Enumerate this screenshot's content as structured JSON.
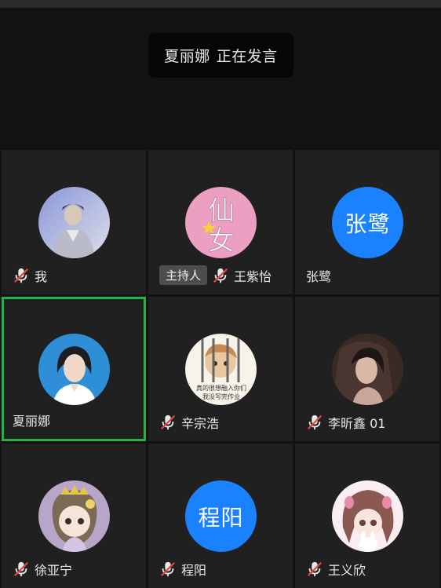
{
  "speaking_banner": {
    "name": "夏丽娜",
    "status": "正在发言"
  },
  "host_badge": "主持人",
  "participants": [
    {
      "name": "我",
      "muted": true,
      "avatar": "photo-man-jacket"
    },
    {
      "name": "王紫怡",
      "muted": true,
      "avatar": "pink-xian-nu",
      "host": true
    },
    {
      "name": "张鹭",
      "muted": false,
      "avatar_text": "张鹭",
      "avatar_color": "#1a82ff"
    },
    {
      "name": "夏丽娜",
      "muted": false,
      "speaking": true,
      "avatar": "photo-woman-portrait"
    },
    {
      "name": "辛宗浩",
      "muted": true,
      "avatar": "cartoon-boy-jail"
    },
    {
      "name": "李昕鑫 01",
      "muted": true,
      "avatar": "photo-woman-dark"
    },
    {
      "name": "徐亚宁",
      "muted": true,
      "avatar": "cartoon-girl-crown"
    },
    {
      "name": "程阳",
      "muted": true,
      "avatar_text": "程阳",
      "avatar_color": "#1a82ff"
    },
    {
      "name": "王义欣",
      "muted": true,
      "avatar": "anime-girl-bunny"
    }
  ],
  "avatar_lettering": {
    "xian_nu": "仙女",
    "jail_caption_1": "真的很想融入你们",
    "jail_caption_2": "我没写完作业"
  },
  "colors": {
    "accent": "#1a82ff",
    "active_border": "#27b247",
    "muted_slash": "#e0463c"
  },
  "icons": [
    "mic-muted-icon"
  ]
}
